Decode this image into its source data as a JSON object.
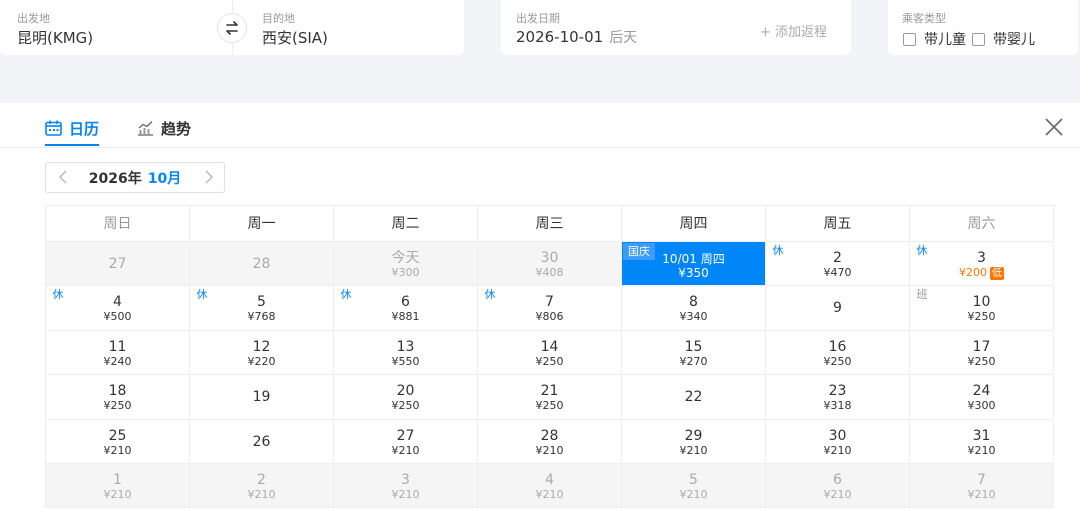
{
  "search": {
    "departure": {
      "label": "出发地",
      "value": "昆明(KMG)"
    },
    "arrival": {
      "label": "目的地",
      "value": "西安(SIA)"
    },
    "date": {
      "label": "出发日期",
      "value": "2026-10-01",
      "hint": "后天"
    },
    "add_return": "+ 添加返程",
    "passenger": {
      "label": "乘客类型",
      "options": [
        "带儿童",
        "带婴儿"
      ]
    }
  },
  "tabs": {
    "calendar": "日历",
    "trend": "趋势"
  },
  "month_nav": {
    "year": "2026年",
    "month": "10月"
  },
  "weekdays": [
    "周日",
    "周一",
    "周二",
    "周三",
    "周四",
    "周五",
    "周六"
  ],
  "weeks": [
    [
      {
        "label": "27",
        "price": "",
        "state": "muted"
      },
      {
        "label": "28",
        "price": "",
        "state": "muted"
      },
      {
        "label": "今天",
        "price": "¥300",
        "state": "muted"
      },
      {
        "label": "30",
        "price": "¥408",
        "state": "muted"
      },
      {
        "label": "10/01 周四",
        "price": "¥350",
        "state": "selected",
        "tag": "国庆",
        "tag_type": "holiday"
      },
      {
        "label": "2",
        "price": "¥470",
        "tag": "休"
      },
      {
        "label": "3",
        "price": "¥200",
        "tag": "休",
        "low": "低"
      }
    ],
    [
      {
        "label": "4",
        "price": "¥500",
        "tag": "休"
      },
      {
        "label": "5",
        "price": "¥768",
        "tag": "休"
      },
      {
        "label": "6",
        "price": "¥881",
        "tag": "休"
      },
      {
        "label": "7",
        "price": "¥806",
        "tag": "休"
      },
      {
        "label": "8",
        "price": "¥340"
      },
      {
        "label": "9",
        "price": ""
      },
      {
        "label": "10",
        "price": "¥250",
        "tag": "班",
        "tag_type": "work"
      }
    ],
    [
      {
        "label": "11",
        "price": "¥240"
      },
      {
        "label": "12",
        "price": "¥220"
      },
      {
        "label": "13",
        "price": "¥550"
      },
      {
        "label": "14",
        "price": "¥250"
      },
      {
        "label": "15",
        "price": "¥270"
      },
      {
        "label": "16",
        "price": "¥250"
      },
      {
        "label": "17",
        "price": "¥250"
      }
    ],
    [
      {
        "label": "18",
        "price": "¥250"
      },
      {
        "label": "19",
        "price": ""
      },
      {
        "label": "20",
        "price": "¥250"
      },
      {
        "label": "21",
        "price": "¥250"
      },
      {
        "label": "22",
        "price": ""
      },
      {
        "label": "23",
        "price": "¥318"
      },
      {
        "label": "24",
        "price": "¥300"
      }
    ],
    [
      {
        "label": "25",
        "price": "¥210"
      },
      {
        "label": "26",
        "price": ""
      },
      {
        "label": "27",
        "price": "¥210"
      },
      {
        "label": "28",
        "price": "¥210"
      },
      {
        "label": "29",
        "price": "¥210"
      },
      {
        "label": "30",
        "price": "¥210"
      },
      {
        "label": "31",
        "price": "¥210"
      }
    ],
    [
      {
        "label": "1",
        "price": "¥210",
        "state": "muted"
      },
      {
        "label": "2",
        "price": "¥210",
        "state": "muted"
      },
      {
        "label": "3",
        "price": "¥210",
        "state": "muted"
      },
      {
        "label": "4",
        "price": "¥210",
        "state": "muted"
      },
      {
        "label": "5",
        "price": "¥210",
        "state": "muted"
      },
      {
        "label": "6",
        "price": "¥210",
        "state": "muted"
      },
      {
        "label": "7",
        "price": "¥210",
        "state": "muted"
      }
    ]
  ],
  "colors": {
    "accent": "#0086f6",
    "low_price": "#ff7700",
    "holiday_tag": "#3c9cf7"
  },
  "icons": {
    "swap": "swap-icon",
    "calendar": "calendar-icon",
    "trend": "trend-chart-icon",
    "close": "close-icon",
    "prev": "chevron-left-icon",
    "next": "chevron-right-icon"
  }
}
